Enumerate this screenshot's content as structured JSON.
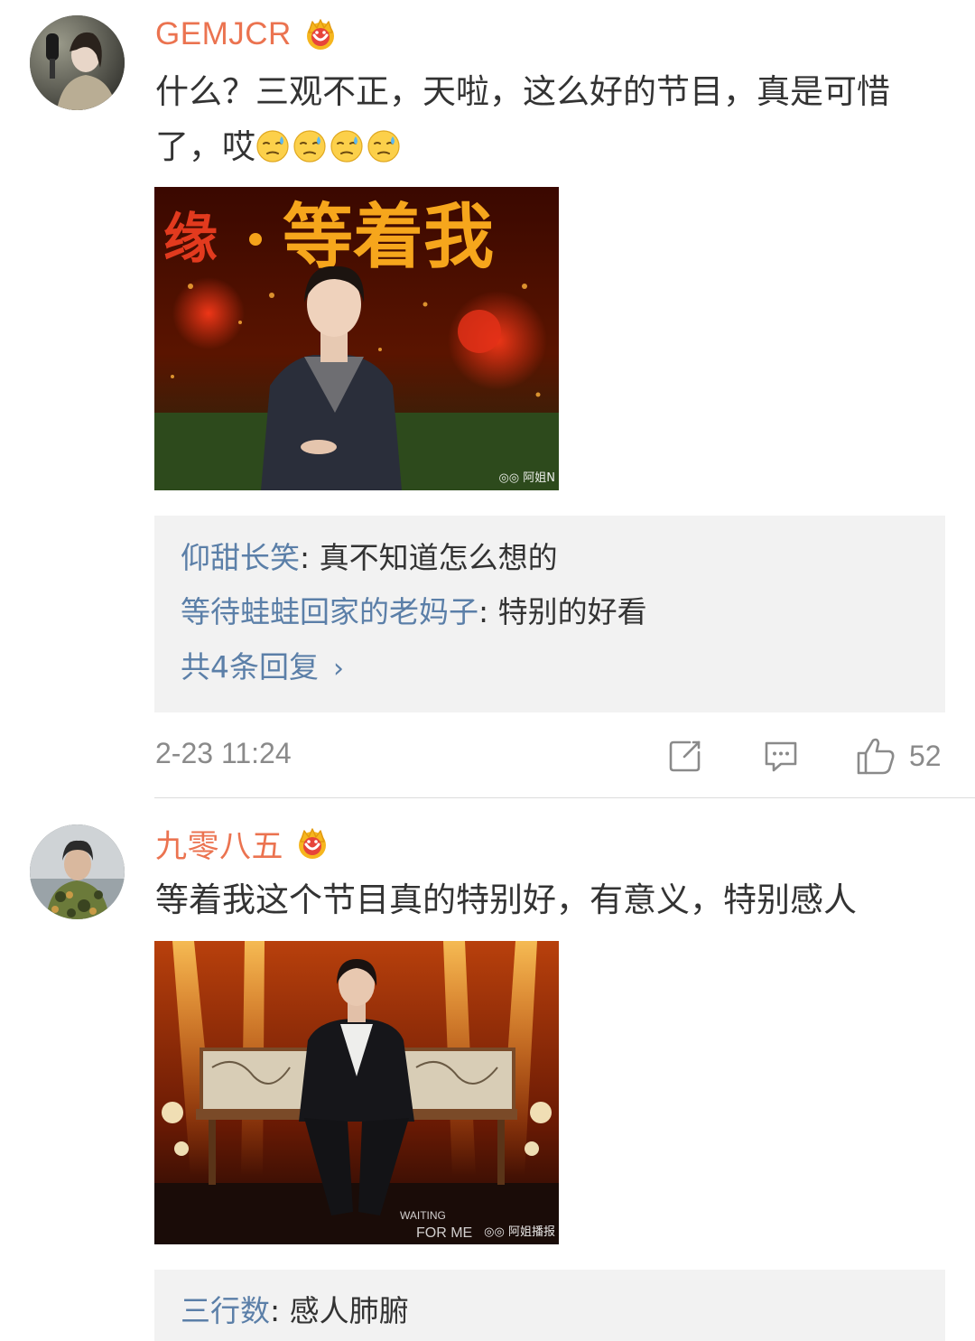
{
  "comments": [
    {
      "username": "GEMJCR",
      "badge_icon": "crown-vip-icon",
      "text_prefix": "什么？三观不正，天啦，这么好的节目，真是可惜了，哎",
      "emoji_icon": "sweat-face-emoji-icon",
      "photo": {
        "headline": "缘·等着我",
        "watermark": "◎◎ 阿姐N"
      },
      "replies": [
        {
          "author": "仰甜长笑",
          "text": "真不知道怎么想的"
        },
        {
          "author": "等待蛙蛙回家的老妈子",
          "text": "特别的好看"
        }
      ],
      "more_replies": "共4条回复",
      "timestamp": "2-23 11:24",
      "like_count": "52"
    },
    {
      "username": "九零八五",
      "badge_icon": "crown-vip-icon",
      "text": "等着我这个节目真的特别好，有意义，特别感人",
      "photo": {
        "caption_line1": "WAITING",
        "caption_line2": "FOR ME",
        "watermark": "◎◎ 阿姐播报"
      },
      "replies": [
        {
          "author": "三行数",
          "text": "感人肺腑"
        }
      ]
    }
  ],
  "colors": {
    "username": "#eb7350",
    "reply_author": "#5b7fa8",
    "meta_gray": "#8a8a8a",
    "reply_bg": "#f2f2f2"
  }
}
